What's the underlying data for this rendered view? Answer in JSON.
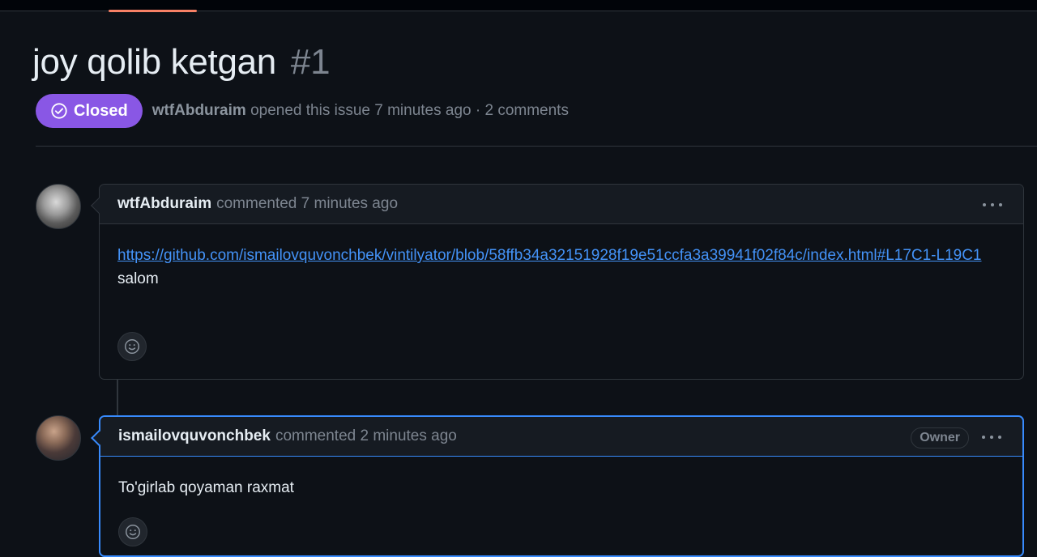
{
  "issue": {
    "title": "joy qolib ketgan",
    "number": "#1",
    "state": "Closed",
    "author": "wtfAbduraim",
    "opened_text": "opened this issue 7 minutes ago · 2 comments"
  },
  "comments": [
    {
      "author": "wtfAbduraim",
      "action": "commented 7 minutes ago",
      "link": "https://github.com/ismailovquvonchbek/vintilyator/blob/58ffb34a32151928f19e51ccfa3a39941f02f84c/index.html#L17C1-L19C1",
      "text": "salom"
    },
    {
      "author": "ismailovquvonchbek",
      "action": "commented 2 minutes ago",
      "badge": "Owner",
      "text": "To'girlab qoyaman raxmat"
    }
  ],
  "colors": {
    "closed_badge": "#8957e5",
    "link": "#4493f8",
    "highlight_border": "#388bfd"
  }
}
